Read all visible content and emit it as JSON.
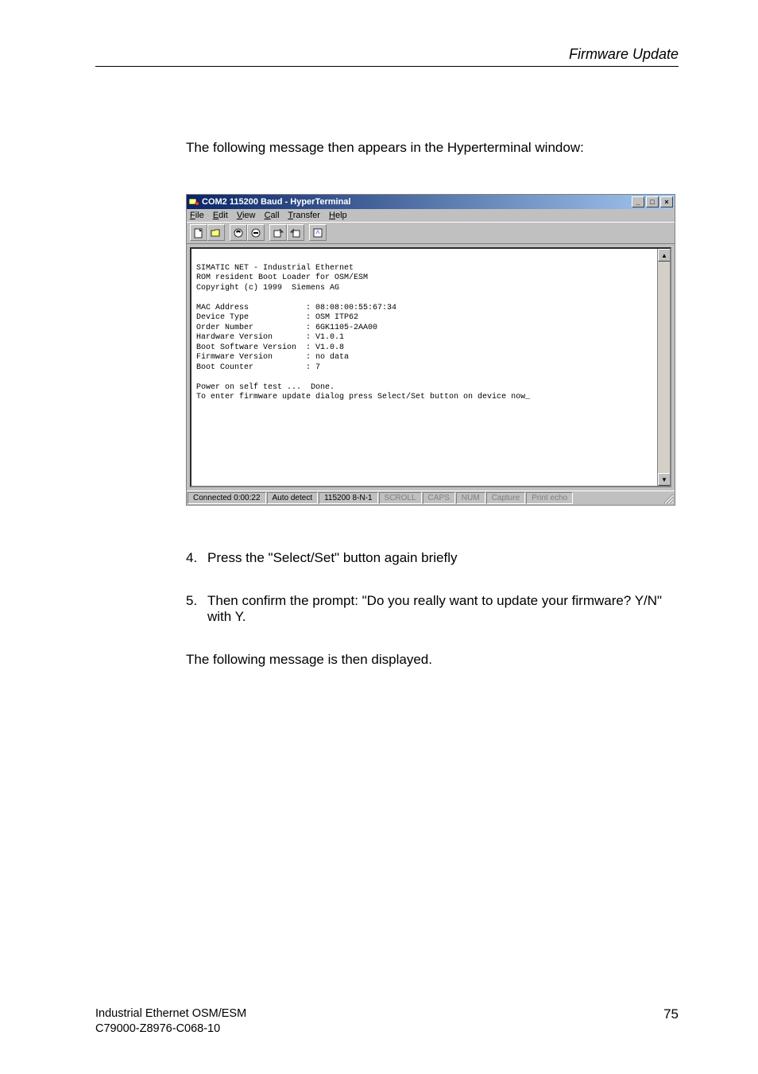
{
  "header_title": "Firmware Update",
  "intro": "The following message then appears in the Hyperterminal window:",
  "window": {
    "title": "COM2 115200 Baud - HyperTerminal",
    "menus": {
      "file": "File",
      "edit": "Edit",
      "view": "View",
      "call": "Call",
      "transfer": "Transfer",
      "help": "Help"
    },
    "sysbuttons": {
      "min": "_",
      "max": "□",
      "close": "×"
    },
    "scroll": {
      "up": "▲",
      "down": "▼"
    },
    "terminal_text": "\nSIMATIC NET - Industrial Ethernet\nROM resident Boot Loader for OSM/ESM\nCopyright (c) 1999  Siemens AG\n\nMAC Address            : 08:08:00:55:67:34\nDevice Type            : OSM ITP62\nOrder Number           : 6GK1105-2AA00\nHardware Version       : V1.0.1\nBoot Software Version  : V1.0.8\nFirmware Version       : no data\nBoot Counter           : 7\n\nPower on self test ...  Done.\nTo enter firmware update dialog press Select/Set button on device now_",
    "status": {
      "connected": "Connected 0:00:22",
      "mode": "Auto detect",
      "params": "115200 8-N-1",
      "scroll": "SCROLL",
      "caps": "CAPS",
      "num": "NUM",
      "capture": "Capture",
      "echo": "Print echo"
    }
  },
  "step4_num": "4.",
  "step4_text": "Press the \"Select/Set\" button again briefly",
  "step5_num": "5.",
  "step5_text": "Then confirm the prompt: \"Do you really want to update your firmware? Y/N\" with Y.",
  "outro": "The following message is then displayed.",
  "footer": {
    "line1": "Industrial Ethernet OSM/ESM",
    "line2": "C79000-Z8976-C068-10",
    "page": "75"
  }
}
